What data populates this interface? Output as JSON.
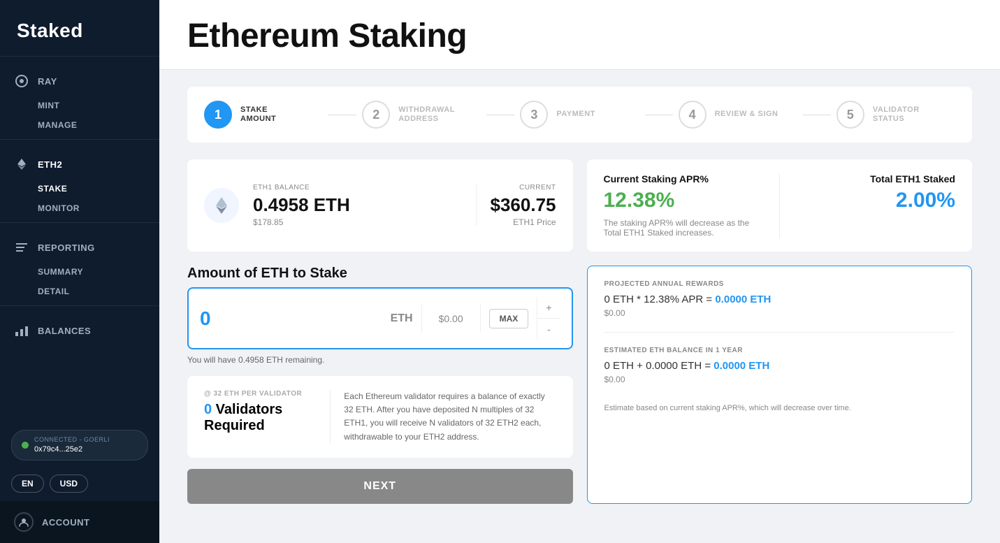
{
  "sidebar": {
    "logo": "Staked",
    "sections": [
      {
        "main_label": "RAY",
        "icon": "ray-icon",
        "sub_items": [
          "MINT",
          "MANAGE"
        ]
      },
      {
        "main_label": "ETH2",
        "icon": "eth-icon",
        "sub_items": [
          "STAKE",
          "MONITOR"
        ]
      },
      {
        "main_label": "REPORTING",
        "icon": "reporting-icon",
        "sub_items": [
          "SUMMARY",
          "DETAIL"
        ]
      },
      {
        "main_label": "BALANCES",
        "icon": "balances-icon",
        "sub_items": []
      }
    ],
    "connected": {
      "label": "CONNECTED - GOERLI",
      "address": "0x79c4...25e2"
    },
    "language_btn": "EN",
    "currency_btn": "USD",
    "account_label": "ACCOUNT"
  },
  "header": {
    "title": "Ethereum Staking"
  },
  "steps": [
    {
      "number": "1",
      "label": "STAKE\nAMOUNT",
      "active": true
    },
    {
      "number": "2",
      "label": "WITHDRAWAL\nADDRESS",
      "active": false
    },
    {
      "number": "3",
      "label": "PAYMENT",
      "active": false
    },
    {
      "number": "4",
      "label": "REVIEW & SIGN",
      "active": false
    },
    {
      "number": "5",
      "label": "VALIDATOR\nSTATUS",
      "active": false
    }
  ],
  "steps_labels": {
    "s1_line1": "STAKE",
    "s1_line2": "AMOUNT",
    "s2_line1": "WITHDRAWAL",
    "s2_line2": "ADDRESS",
    "s3": "PAYMENT",
    "s4": "REVIEW & SIGN",
    "s5_line1": "VALIDATOR",
    "s5_line2": "STATUS"
  },
  "balance": {
    "label": "ETH1 BALANCE",
    "eth_amount": "0.4958 ETH",
    "usd_amount": "$178.85",
    "current_label": "CURRENT",
    "current_price": "$360.75",
    "current_sub": "ETH1 Price"
  },
  "apr": {
    "title": "Current Staking APR%",
    "value": "12.38%",
    "total_title": "Total ETH1 Staked",
    "total_value": "2.00%",
    "note": "The staking APR% will decrease as the Total ETH1 Staked increases."
  },
  "stake_input": {
    "section_title": "Amount of ETH to Stake",
    "amount": "0",
    "eth_label": "ETH",
    "usd_equiv": "$0.00",
    "max_label": "MAX",
    "plus_label": "+",
    "minus_label": "-",
    "remaining_text": "You will have 0.4958 ETH remaining."
  },
  "validators": {
    "per_label": "@ 32 ETH PER VALIDATOR",
    "count_prefix": "0",
    "count_suffix": " Validators Required",
    "description": "Each Ethereum validator requires a balance of exactly 32 ETH. After you have deposited N multiples of 32 ETH1, you will receive N validators of 32 ETH2 each, withdrawable to your ETH2 address."
  },
  "rewards": {
    "projected_label": "PROJECTED ANNUAL REWARDS",
    "formula": "0 ETH * 12.38% APR = ",
    "formula_highlight": "0.0000 ETH",
    "formula_usd": "$0.00",
    "balance_label": "ESTIMATED ETH BALANCE IN 1 YEAR",
    "balance_formula": "0 ETH + 0.0000 ETH = ",
    "balance_highlight": "0.0000 ETH",
    "balance_usd": "$0.00",
    "note": "Estimate based on current staking APR%, which will decrease over time."
  },
  "next_btn": "NEXT"
}
